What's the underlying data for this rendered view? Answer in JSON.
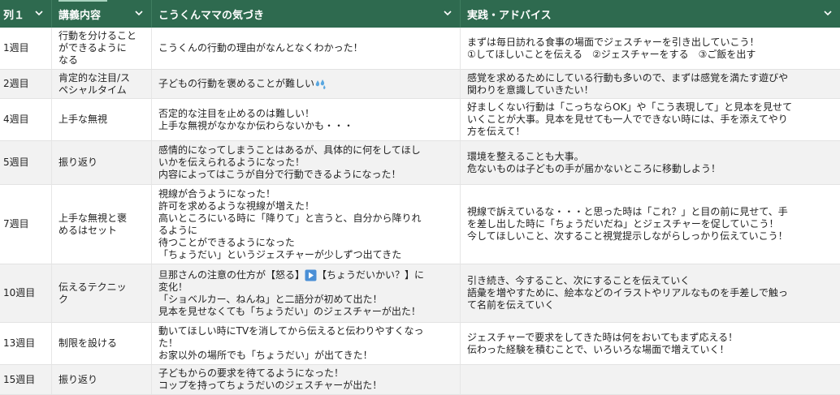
{
  "header": {
    "col1": "列１",
    "col2": "講義内容",
    "col3": "こうくんママの気づき",
    "col4": "実践・アドバイス"
  },
  "colors": {
    "header_bg": "#2e6a4f",
    "row_alt_bg": "#f2f2f2",
    "play_icon": "#4a8fd6",
    "sweat_icon": "#5aa7e0"
  },
  "rows": [
    {
      "week": "1週目",
      "topic": "行動を分けること\nができるように\nなる",
      "notice": "こうくんの行動の理由がなんとなくわかった！",
      "advice": "まずは毎日訪れる食事の場面でジェスチャーを引き出していこう！\n①してほしいことを伝える　②ジェスチャーをする　③ご飯を出す"
    },
    {
      "week": "2週目",
      "topic": "肯定的な注目/ス\nペシャルタイム",
      "notice": "子どもの行動を褒めることが難しい",
      "notice_icon": "sweat-droplets-icon",
      "advice": "感覚を求めるためにしている行動も多いので、まずは感覚を満たす遊びや\n関わりを意識していきたい！"
    },
    {
      "week": "4週目",
      "topic": "上手な無視",
      "notice": "否定的な注目を止めるのは難しい！\n上手な無視がなかなか伝わらないかも・・・",
      "advice": "好ましくない行動は「こっちならOK」や「こう表現して」と見本を見せて\nいくことが大事。見本を見せても一人でできない時には、手を添えてやり\n方を伝えて！"
    },
    {
      "week": "5週目",
      "topic": "振り返り",
      "notice": "感情的になってしまうことはあるが、具体的に何をしてほし\nいかを伝えられるようになった！\n内容によってはこうが自分で行動できるようになった！",
      "advice": "環境を整えることも大事。\n危ないものは子どもの手が届かないところに移動しよう！"
    },
    {
      "week": "7週目",
      "topic": "上手な無視と褒\nめるはセット",
      "notice": "視線が合うようになった！\n許可を求めるような視線が増えた！\n高いところにいる時に「降りて」と言うと、自分から降りれ\nるように\n待つことができるようになった\n「ちょうだい」というジェスチャーが少しずつ出てきた",
      "advice": "視線で訴えているな・・・と思った時は「これ？」と目の前に見せて、手\nを差し出した時に「ちょうだいだね」とジェスチャーを促していこう！\n今してほしいこと、次すること視覚提示しながらしっかり伝えていこう！"
    },
    {
      "week": "10週目",
      "topic": "伝えるテクニッ\nク",
      "notice_part1": "旦那さんの注意の仕方が【怒る】",
      "notice_icon": "play-arrow-icon",
      "notice_part2": "【ちょうだいかい？】に\n変化！\n「ショベルカー、ねんね」と二語分が初めて出た！\n見本を見せなくても「ちょうだい」のジェスチャーが出た！",
      "advice": "引き続き、今すること、次にすることを伝えていく\n語彙を増やすために、絵本などのイラストやリアルなものを手差しで触っ\nて名前を伝えていく"
    },
    {
      "week": "13週目",
      "topic": "制限を設ける",
      "notice": "動いてほしい時にTVを消してから伝えると伝わりやすくなっ\nた！\nお家以外の場所でも「ちょうだい」が出てきた！",
      "advice": "ジェスチャーで要求をしてきた時は何をおいてもまず応える！\n伝わった経験を積むことで、いろいろな場面で増えていく！"
    },
    {
      "week": "15週目",
      "topic": "振り返り",
      "notice": "子どもからの要求を待てるようになった！\nコップを持ってちょうだいのジェスチャーが出た！",
      "advice": ""
    }
  ]
}
